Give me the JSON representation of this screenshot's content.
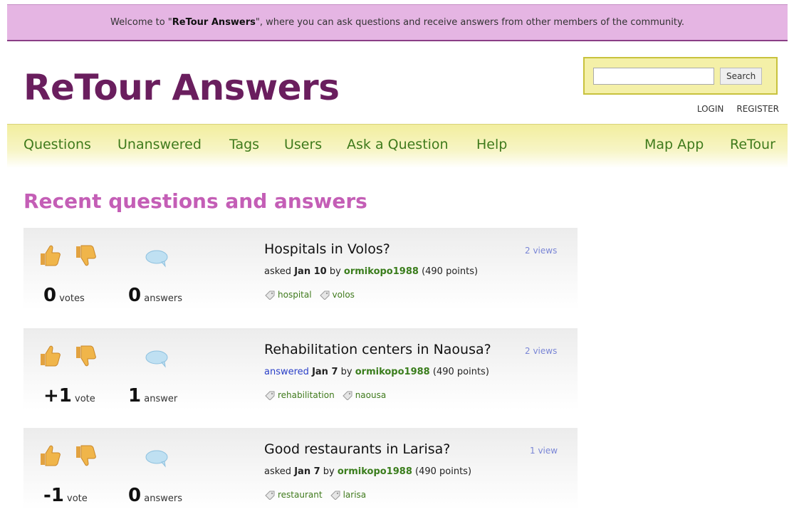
{
  "notice": {
    "prefix": "Welcome to \"",
    "site_name": "ReTour Answers",
    "suffix": "\", where you can ask questions and receive answers from other members of the community."
  },
  "header": {
    "logo": "ReTour Answers",
    "search": {
      "placeholder": "",
      "value": "",
      "button": "Search"
    },
    "login": "LOGIN",
    "register": "REGISTER"
  },
  "nav": {
    "items": [
      "Questions",
      "Unanswered",
      "Tags",
      "Users",
      "Ask a Question",
      "Help"
    ],
    "right_items": [
      "Map App",
      "ReTour"
    ]
  },
  "main": {
    "title": "Recent questions and answers",
    "questions": [
      {
        "votes_num": "0",
        "votes_label": "votes",
        "answers_num": "0",
        "answers_label": "answers",
        "title": "Hospitals in Volos?",
        "action": "asked",
        "date": "Jan 10",
        "by": "by",
        "user": "ormikopo1988",
        "points": "(490 points)",
        "tags": [
          "hospital",
          "volos"
        ],
        "views": "2 views"
      },
      {
        "votes_num": "+1",
        "votes_label": "vote",
        "answers_num": "1",
        "answers_label": "answer",
        "title": "Rehabilitation centers in Naousa?",
        "action": "answered",
        "date": "Jan 7",
        "by": "by",
        "user": "ormikopo1988",
        "points": "(490 points)",
        "tags": [
          "rehabilitation",
          "naousa"
        ],
        "views": "2 views"
      },
      {
        "votes_num": "-1",
        "votes_label": "vote",
        "answers_num": "0",
        "answers_label": "answers",
        "title": "Good restaurants in Larisa?",
        "action": "asked",
        "date": "Jan 7",
        "by": "by",
        "user": "ormikopo1988",
        "points": "(490 points)",
        "tags": [
          "restaurant",
          "larisa"
        ],
        "views": "1 view"
      }
    ]
  },
  "colors": {
    "notice_bg": "#e5b5e3",
    "logo": "#6a1e5e",
    "nav_link": "#3f7a1c",
    "section_title": "#c45eb6",
    "user_link": "#3a7d1c",
    "views": "#7a86d6"
  }
}
